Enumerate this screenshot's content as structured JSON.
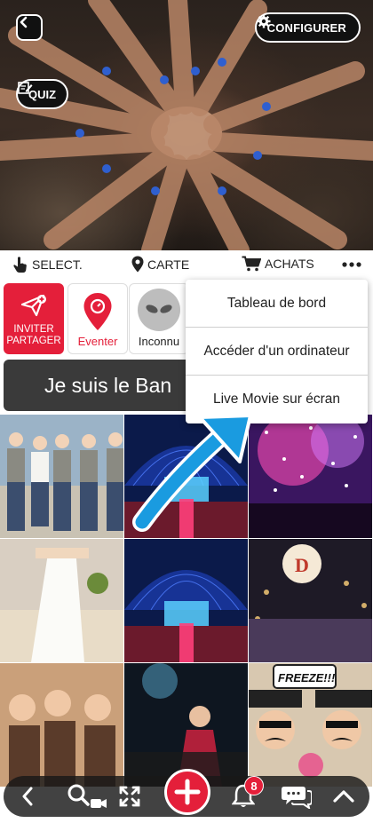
{
  "header": {
    "configure_label": "CONFIGURER",
    "quiz_label": "QUIZ"
  },
  "toolbar": {
    "select_label": "SELECT.",
    "map_label": "CARTE",
    "purchases_label": "ACHATS"
  },
  "tiles": {
    "invite_line1": "INVITER",
    "invite_line2": "PARTAGER",
    "eventer_label": "Eventer",
    "unknown_label": "Inconnu"
  },
  "banner": {
    "text": "Je suis le Ban"
  },
  "menu": {
    "items": [
      {
        "label": "Tableau de bord"
      },
      {
        "label": "Accéder d'un ordinateur"
      },
      {
        "label": "Live Movie sur écran"
      }
    ]
  },
  "grid": {
    "freeze_sign": "FREEZE!!!",
    "balloon_letter": "D"
  },
  "bottom_bar": {
    "notification_count": "8"
  },
  "colors": {
    "accent_red": "#e41f3a",
    "arrow_blue": "#1a9be0",
    "dark": "#111111"
  },
  "icons": [
    "back-icon",
    "gear-icon",
    "edit-icon",
    "pointer-hand-icon",
    "location-pin-icon",
    "cart-icon",
    "more-dots-icon",
    "paper-plane-icon",
    "eventer-logo-icon",
    "alien-icon",
    "chevron-left-icon",
    "search-icon",
    "video-icon",
    "expand-icon",
    "plus-icon",
    "bell-icon",
    "chat-icon",
    "chevron-up-icon"
  ]
}
